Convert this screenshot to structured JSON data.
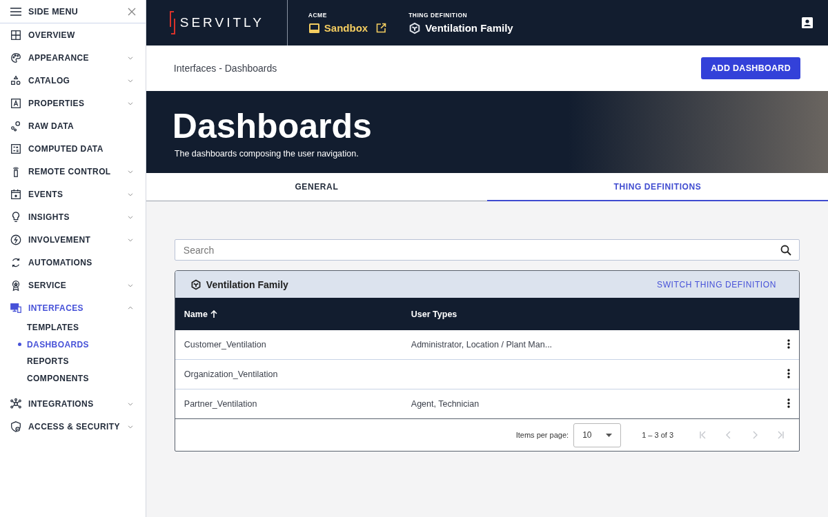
{
  "side_menu": {
    "title": "SIDE MENU",
    "items": [
      {
        "label": "OVERVIEW",
        "kind": "link",
        "selected": false
      },
      {
        "label": "APPEARANCE",
        "kind": "group",
        "expanded": false,
        "selected": false
      },
      {
        "label": "CATALOG",
        "kind": "group",
        "expanded": false,
        "selected": false
      },
      {
        "label": "PROPERTIES",
        "kind": "group",
        "expanded": false,
        "selected": false
      },
      {
        "label": "RAW DATA",
        "kind": "link",
        "selected": false
      },
      {
        "label": "COMPUTED DATA",
        "kind": "link",
        "selected": false
      },
      {
        "label": "REMOTE CONTROL",
        "kind": "group",
        "expanded": false,
        "selected": false
      },
      {
        "label": "EVENTS",
        "kind": "group",
        "expanded": false,
        "selected": false
      },
      {
        "label": "INSIGHTS",
        "kind": "group",
        "expanded": false,
        "selected": false
      },
      {
        "label": "INVOLVEMENT",
        "kind": "group",
        "expanded": false,
        "selected": false
      },
      {
        "label": "AUTOMATIONS",
        "kind": "link",
        "selected": false
      },
      {
        "label": "SERVICE",
        "kind": "group",
        "expanded": false,
        "selected": false
      },
      {
        "label": "INTERFACES",
        "kind": "group",
        "expanded": true,
        "selected": true,
        "children": [
          {
            "label": "TEMPLATES",
            "selected": false
          },
          {
            "label": "DASHBOARDS",
            "selected": true
          },
          {
            "label": "REPORTS",
            "selected": false
          },
          {
            "label": "COMPONENTS",
            "selected": false
          }
        ]
      },
      {
        "label": "INTEGRATIONS",
        "kind": "group",
        "expanded": false,
        "selected": false
      },
      {
        "label": "ACCESS & SECURITY",
        "kind": "group",
        "expanded": false,
        "selected": false
      }
    ]
  },
  "header": {
    "logo": "SERVITLY",
    "tenant_label": "ACME",
    "tenant": "Sandbox",
    "thing_label": "THING DEFINITION",
    "thing": "Ventilation Family"
  },
  "toolbar": {
    "breadcrumb": "Interfaces - Dashboards",
    "button": "ADD DASHBOARD"
  },
  "hero": {
    "title": "Dashboards",
    "subtitle": "The dashboards composing the user navigation."
  },
  "tabs": [
    {
      "label": "GENERAL",
      "selected": false
    },
    {
      "label": "THING DEFINITIONS",
      "selected": true
    }
  ],
  "search": {
    "placeholder": "Search"
  },
  "card": {
    "title": "Ventilation Family",
    "link": "SWITCH THING DEFINITION"
  },
  "table": {
    "columns": [
      {
        "label": "Name",
        "sorted": true
      },
      {
        "label": "User Types",
        "sorted": false
      }
    ],
    "rows": [
      [
        "Customer_Ventilation",
        "Administrator, Location / Plant Man..."
      ],
      [
        "Organization_Ventilation",
        ""
      ],
      [
        "Partner_Ventilation",
        "Agent, Technician"
      ]
    ]
  },
  "paginator": {
    "label": "Items per page:",
    "page_size": "10",
    "range": "1 – 3 of 3",
    "first_disabled": true,
    "previous_disabled": true,
    "next_disabled": true,
    "last_disabled": true
  }
}
